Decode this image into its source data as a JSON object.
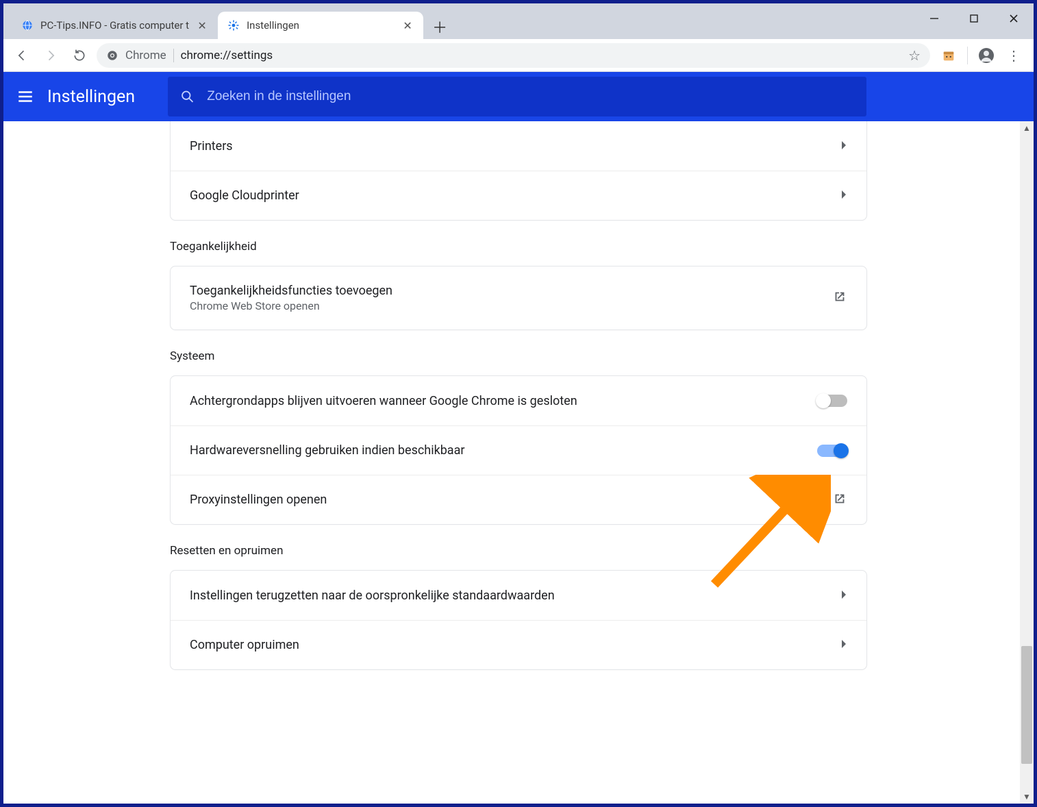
{
  "window": {
    "tabs": [
      {
        "title": "PC-Tips.INFO - Gratis computer t",
        "active": false,
        "favicon": "globe"
      },
      {
        "title": "Instellingen",
        "active": true,
        "favicon": "gear"
      }
    ],
    "address_chip": "Chrome",
    "address_path": "chrome://settings"
  },
  "appbar": {
    "title": "Instellingen",
    "search_placeholder": "Zoeken in de instellingen"
  },
  "sections": {
    "print": {
      "rows": [
        {
          "label": "Printers"
        },
        {
          "label": "Google Cloudprinter"
        }
      ]
    },
    "accessibility": {
      "title": "Toegankelijkheid",
      "row": {
        "label": "Toegankelijkheidsfuncties toevoegen",
        "sublabel": "Chrome Web Store openen"
      }
    },
    "system": {
      "title": "Systeem",
      "rows": {
        "bg_apps": {
          "label": "Achtergrondapps blijven uitvoeren wanneer Google Chrome is gesloten",
          "on": false
        },
        "hw_accel": {
          "label": "Hardwareversnelling gebruiken indien beschikbaar",
          "on": true
        },
        "proxy": {
          "label": "Proxyinstellingen openen"
        }
      }
    },
    "reset": {
      "title": "Resetten en opruimen",
      "rows": [
        {
          "label": "Instellingen terugzetten naar de oorspronkelijke standaardwaarden"
        },
        {
          "label": "Computer opruimen"
        }
      ]
    }
  }
}
